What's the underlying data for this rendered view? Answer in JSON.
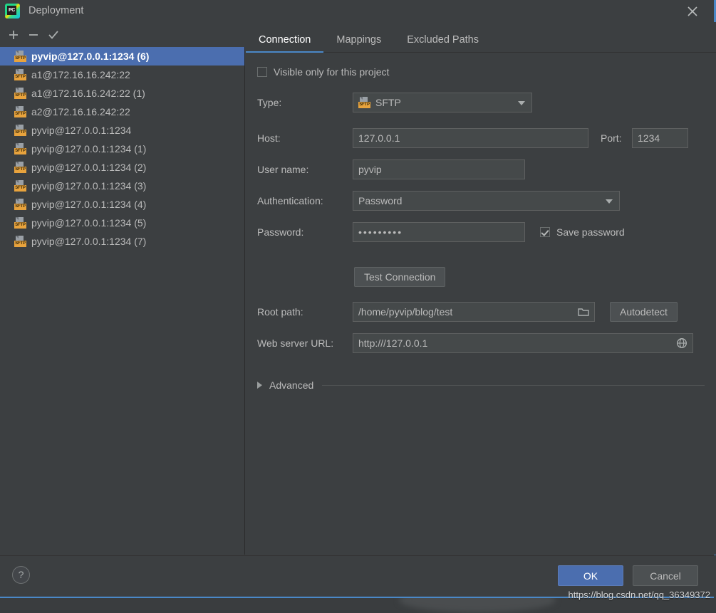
{
  "window": {
    "title": "Deployment",
    "logo_icon": "pycharm-logo",
    "logo_text": "PC",
    "close_icon": "close-icon"
  },
  "toolbar": {
    "add_icon": "plus-icon",
    "remove_icon": "minus-icon",
    "set_default_icon": "check-icon"
  },
  "server_list": {
    "items": [
      {
        "label": "pyvip@127.0.0.1:1234 (6)",
        "icon": "sftp-icon",
        "icon_text": "SFTP",
        "selected": true
      },
      {
        "label": "a1@172.16.16.242:22",
        "icon": "sftp-icon",
        "icon_text": "SFTP",
        "selected": false
      },
      {
        "label": "a1@172.16.16.242:22 (1)",
        "icon": "sftp-icon",
        "icon_text": "SFTP",
        "selected": false
      },
      {
        "label": "a2@172.16.16.242:22",
        "icon": "sftp-icon",
        "icon_text": "SFTP",
        "selected": false
      },
      {
        "label": "pyvip@127.0.0.1:1234",
        "icon": "sftp-icon",
        "icon_text": "SFTP",
        "selected": false
      },
      {
        "label": "pyvip@127.0.0.1:1234 (1)",
        "icon": "sftp-icon",
        "icon_text": "SFTP",
        "selected": false
      },
      {
        "label": "pyvip@127.0.0.1:1234 (2)",
        "icon": "sftp-icon",
        "icon_text": "SFTP",
        "selected": false
      },
      {
        "label": "pyvip@127.0.0.1:1234 (3)",
        "icon": "sftp-icon",
        "icon_text": "SFTP",
        "selected": false
      },
      {
        "label": "pyvip@127.0.0.1:1234 (4)",
        "icon": "sftp-icon",
        "icon_text": "SFTP",
        "selected": false
      },
      {
        "label": "pyvip@127.0.0.1:1234 (5)",
        "icon": "sftp-icon",
        "icon_text": "SFTP",
        "selected": false
      },
      {
        "label": "pyvip@127.0.0.1:1234 (7)",
        "icon": "sftp-icon",
        "icon_text": "SFTP",
        "selected": false
      }
    ]
  },
  "tabs": [
    {
      "label": "Connection",
      "active": true
    },
    {
      "label": "Mappings",
      "active": false
    },
    {
      "label": "Excluded Paths",
      "active": false
    }
  ],
  "connection": {
    "visible_only_label": "Visible only for this project",
    "visible_only_checked": false,
    "type_label": "Type:",
    "type_value": "SFTP",
    "type_icon": "sftp-icon",
    "type_icon_text": "SFTP",
    "host_label": "Host:",
    "host_value": "127.0.0.1",
    "port_label": "Port:",
    "port_value": "1234",
    "username_label": "User name:",
    "username_value": "pyvip",
    "auth_label": "Authentication:",
    "auth_value": "Password",
    "password_label": "Password:",
    "password_value": "•••••••••",
    "save_password_label": "Save password",
    "save_password_checked": true,
    "test_connection_label": "Test Connection",
    "root_path_label": "Root path:",
    "root_path_value": "/home/pyvip/blog/test",
    "root_path_browse_icon": "folder-icon",
    "autodetect_label": "Autodetect",
    "web_url_label": "Web server URL:",
    "web_url_value": "http:///127.0.0.1",
    "web_url_open_icon": "globe-icon",
    "advanced_label": "Advanced",
    "advanced_expand_icon": "triangle-right-icon"
  },
  "footer": {
    "help_label": "?",
    "ok_label": "OK",
    "cancel_label": "Cancel"
  },
  "watermark": "https://blog.csdn.net/qq_36349372",
  "colors": {
    "background": "#3c3f41",
    "selection": "#4b6eaf",
    "accent": "#4a88c7",
    "field_bg": "#45494a",
    "sftp_tag": "#e8a33d"
  }
}
